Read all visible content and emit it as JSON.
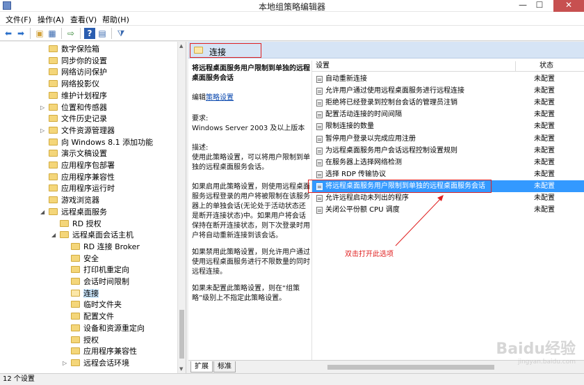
{
  "window": {
    "title": "本地组策略编辑器",
    "controls": {
      "minimize": "—",
      "maximize": "☐",
      "close": "✕"
    }
  },
  "menu": [
    "文件(F)",
    "操作(A)",
    "查看(V)",
    "帮助(H)"
  ],
  "toolbar_icons": [
    "back-arrow-icon",
    "forward-arrow-icon",
    "up-folder-icon",
    "show-tree-icon",
    "export-list-icon",
    "help-icon",
    "properties-icon",
    "filter-icon"
  ],
  "tree": {
    "items": [
      {
        "label": "数字保险箱",
        "indent": 0,
        "expander": "",
        "selected": false
      },
      {
        "label": "同步你的设置",
        "indent": 0,
        "expander": "",
        "selected": false
      },
      {
        "label": "网络访问保护",
        "indent": 0,
        "expander": "",
        "selected": false
      },
      {
        "label": "网络投影仪",
        "indent": 0,
        "expander": "",
        "selected": false
      },
      {
        "label": "维护计划程序",
        "indent": 0,
        "expander": "",
        "selected": false
      },
      {
        "label": "位置和传感器",
        "indent": 0,
        "expander": "▷",
        "selected": false
      },
      {
        "label": "文件历史记录",
        "indent": 0,
        "expander": "",
        "selected": false
      },
      {
        "label": "文件资源管理器",
        "indent": 0,
        "expander": "▷",
        "selected": false
      },
      {
        "label": "向 Windows 8.1 添加功能",
        "indent": 0,
        "expander": "",
        "selected": false
      },
      {
        "label": "演示文稿设置",
        "indent": 0,
        "expander": "",
        "selected": false
      },
      {
        "label": "应用程序包部署",
        "indent": 0,
        "expander": "",
        "selected": false
      },
      {
        "label": "应用程序兼容性",
        "indent": 0,
        "expander": "",
        "selected": false
      },
      {
        "label": "应用程序运行时",
        "indent": 0,
        "expander": "",
        "selected": false
      },
      {
        "label": "游戏浏览器",
        "indent": 0,
        "expander": "",
        "selected": false
      },
      {
        "label": "远程桌面服务",
        "indent": 0,
        "expander": "◢",
        "selected": false
      },
      {
        "label": "RD 授权",
        "indent": 1,
        "expander": "",
        "selected": false
      },
      {
        "label": "远程桌面会话主机",
        "indent": 1,
        "expander": "◢",
        "selected": false
      },
      {
        "label": "RD 连接 Broker",
        "indent": 2,
        "expander": "",
        "selected": false
      },
      {
        "label": "安全",
        "indent": 2,
        "expander": "",
        "selected": false
      },
      {
        "label": "打印机重定向",
        "indent": 2,
        "expander": "",
        "selected": false
      },
      {
        "label": "会话时间限制",
        "indent": 2,
        "expander": "",
        "selected": false
      },
      {
        "label": "连接",
        "indent": 2,
        "expander": "",
        "selected": true
      },
      {
        "label": "临时文件夹",
        "indent": 2,
        "expander": "",
        "selected": false
      },
      {
        "label": "配置文件",
        "indent": 2,
        "expander": "",
        "selected": false
      },
      {
        "label": "设备和资源重定向",
        "indent": 2,
        "expander": "",
        "selected": false
      },
      {
        "label": "授权",
        "indent": 2,
        "expander": "",
        "selected": false
      },
      {
        "label": "应用程序兼容性",
        "indent": 2,
        "expander": "",
        "selected": false
      },
      {
        "label": "远程会话环境",
        "indent": 2,
        "expander": "▷",
        "selected": false
      }
    ]
  },
  "right": {
    "header": "连接",
    "description": {
      "title": "将远程桌面服务用户限制到单独的远程桌面服务会话",
      "edit_prefix": "编辑",
      "edit_link": "策略设置",
      "req_label": "要求:",
      "req_value": "Windows Server 2003 及以上版本",
      "desc_label": "描述:",
      "p1": "使用此策略设置，可以将用户限制到单独的远程桌面服务会话。",
      "p2": "如果启用此策略设置，则使用远程桌面服务远程登录的用户将被限制在该服务器上的单独会话(无论处于活动状态还是断开连接状态)中。如果用户将会话保持在断开连接状态，则下次登录时用户将自动重新连接到该会话。",
      "p3": "如果禁用此策略设置，则允许用户通过使用远程桌面服务进行不限数量的同时远程连接。",
      "p4": "如果未配置此策略设置，则在“组策略”级别上不指定此策略设置。"
    },
    "columns": {
      "setting": "设置",
      "status": "状态"
    },
    "rows": [
      {
        "name": "自动重新连接",
        "status": "未配置"
      },
      {
        "name": "允许用户通过使用远程桌面服务进行远程连接",
        "status": "未配置"
      },
      {
        "name": "拒绝将已经登录到控制台会话的管理员注销",
        "status": "未配置"
      },
      {
        "name": "配置活动连接的时间间隔",
        "status": "未配置"
      },
      {
        "name": "限制连接的数量",
        "status": "未配置"
      },
      {
        "name": "暂停用户登录以完成应用注册",
        "status": "未配置"
      },
      {
        "name": "为远程桌面服务用户会话远程控制设置规则",
        "status": "未配置"
      },
      {
        "name": "在服务器上选择网络检测",
        "status": "未配置"
      },
      {
        "name": "选择 RDP 传输协议",
        "status": "未配置"
      },
      {
        "name": "将远程桌面服务用户限制到单独的远程桌面服务会话",
        "status": "未配置",
        "selected": true
      },
      {
        "name": "允许远程启动未列出的程序",
        "status": "未配置"
      },
      {
        "name": "关闭公平份额 CPU 调度",
        "status": "未配置"
      }
    ],
    "annotation": "双击打开此选项",
    "tabs": [
      "扩展",
      "标准"
    ]
  },
  "statusbar": {
    "count": "12 个设置"
  },
  "watermark": {
    "logo": "Baidu经验",
    "url": "jingyan.baidu.com"
  }
}
